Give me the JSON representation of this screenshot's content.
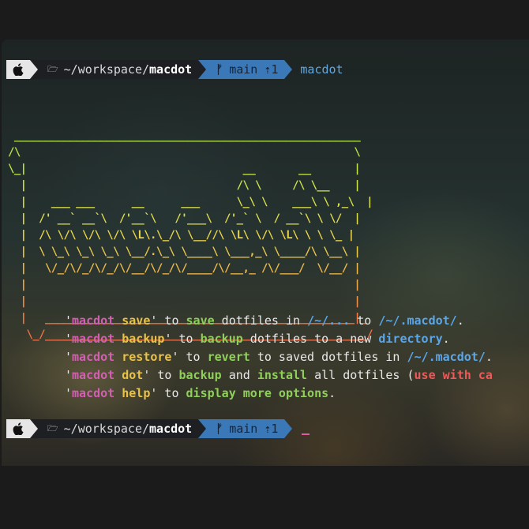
{
  "prompt": {
    "apple_icon": "apple-logo-icon",
    "folder_icon": "folder-icon",
    "dir_prefix": "~/workspace/",
    "dir_name": "macdot",
    "branch_icon": "git-branch-icon",
    "branch_symbol": "ᚠ",
    "branch": "main",
    "ahead": "⇡1",
    "command": "macdot"
  },
  "ascii_art": [
    " ________________________________________________________",
    "/\\                                                      \\",
    "\\_|                                   __       __       |",
    "  |                                  /\\ \\     /\\ \\__    |",
    "  |    ___ ___      __      ___      \\_\\ \\    ___\\ \\ ,_\\  |",
    "  |  /' __` __`\\  /'__`\\   /'___\\  /'_` \\  / __`\\ \\ \\/  |",
    "  |  /\\ \\/\\ \\/\\ \\/\\ \\L\\.\\_/\\ \\__//\\ \\L\\ \\/\\ \\L\\ \\ \\ \\_ |",
    "  |  \\ \\_\\ \\_\\ \\_\\ \\__/.\\_\\ \\____\\ \\___,_\\ \\____/\\ \\__\\ |",
    "  |   \\/_/\\/_/\\/_/\\/__/\\/_/\\/____/\\/__,_ /\\/___/  \\/__/ |",
    "  |                                                     |",
    "  |                                                     |",
    "  |   __________________________________________________|_",
    "   \\_/____________________________________________________/"
  ],
  "help_lines": [
    {
      "cmd": "macdot",
      "arg": "save",
      "verb": "save",
      "p1": " dotfiles in ",
      "path": "/~/...",
      "p2": " to ",
      "path2": "/~/.macdot/",
      "p3": "."
    },
    {
      "cmd": "macdot",
      "arg": "backup",
      "verb": "backup",
      "p1": " dotfiles to a new ",
      "path": "directory",
      "p2": ".",
      "path2": "",
      "p3": ""
    },
    {
      "cmd": "macdot",
      "arg": "restore",
      "verb": "revert",
      "p1": " to saved dotfiles in ",
      "path": "/~/.macdot/",
      "p2": ".",
      "path2": "",
      "p3": ""
    },
    {
      "cmd": "macdot",
      "arg": "dot",
      "verb": "backup",
      "p1": " and ",
      "path": "",
      "p2": "install",
      "path2": " all dotfiles (",
      "p3": "use with ca"
    },
    {
      "cmd": "macdot",
      "arg": "help",
      "verb": "display more options",
      "p1": ".",
      "path": "",
      "p2": "",
      "path2": "",
      "p3": ""
    }
  ],
  "colors": {
    "command_magenta": "#d35fb3",
    "argument_yellow": "#e8c24a",
    "verb_green": "#8ed05a",
    "path_blue": "#5aa6e8",
    "warning_red": "#ec5a5a",
    "git_segment": "#3a78b7"
  }
}
